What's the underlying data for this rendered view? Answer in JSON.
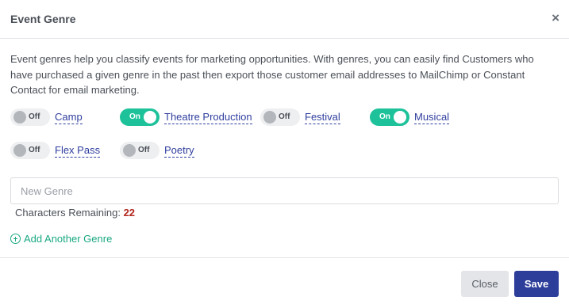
{
  "modal": {
    "title": "Event Genre",
    "close_icon": "close-icon",
    "description": "Event genres help you classify events for marketing opportunities. With genres, you can easily find Customers who have purchased a given genre in the past then export those customer email addresses to MailChimp or Constant Contact for email marketing."
  },
  "genres": [
    {
      "name": "Camp",
      "state": "Off"
    },
    {
      "name": "Theatre Production",
      "state": "On"
    },
    {
      "name": "Festival",
      "state": "Off"
    },
    {
      "name": "Musical",
      "state": "On"
    },
    {
      "name": "Flex Pass",
      "state": "Off"
    },
    {
      "name": "Poetry",
      "state": "Off"
    }
  ],
  "new_genre": {
    "placeholder": "New Genre",
    "value": "",
    "remaining_label": "Characters Remaining:",
    "remaining_count": "22"
  },
  "add_another": {
    "label": "Add Another Genre",
    "icon": "plus-circle-icon"
  },
  "footer": {
    "close_label": "Close",
    "save_label": "Save"
  },
  "colors": {
    "toggle_on": "#1ec29a",
    "toggle_off": "#eeeff1",
    "link": "#2f3e9e",
    "accent_green": "#1aa882",
    "save_button": "#2d3d9a",
    "remaining_count": "#b3261e"
  }
}
